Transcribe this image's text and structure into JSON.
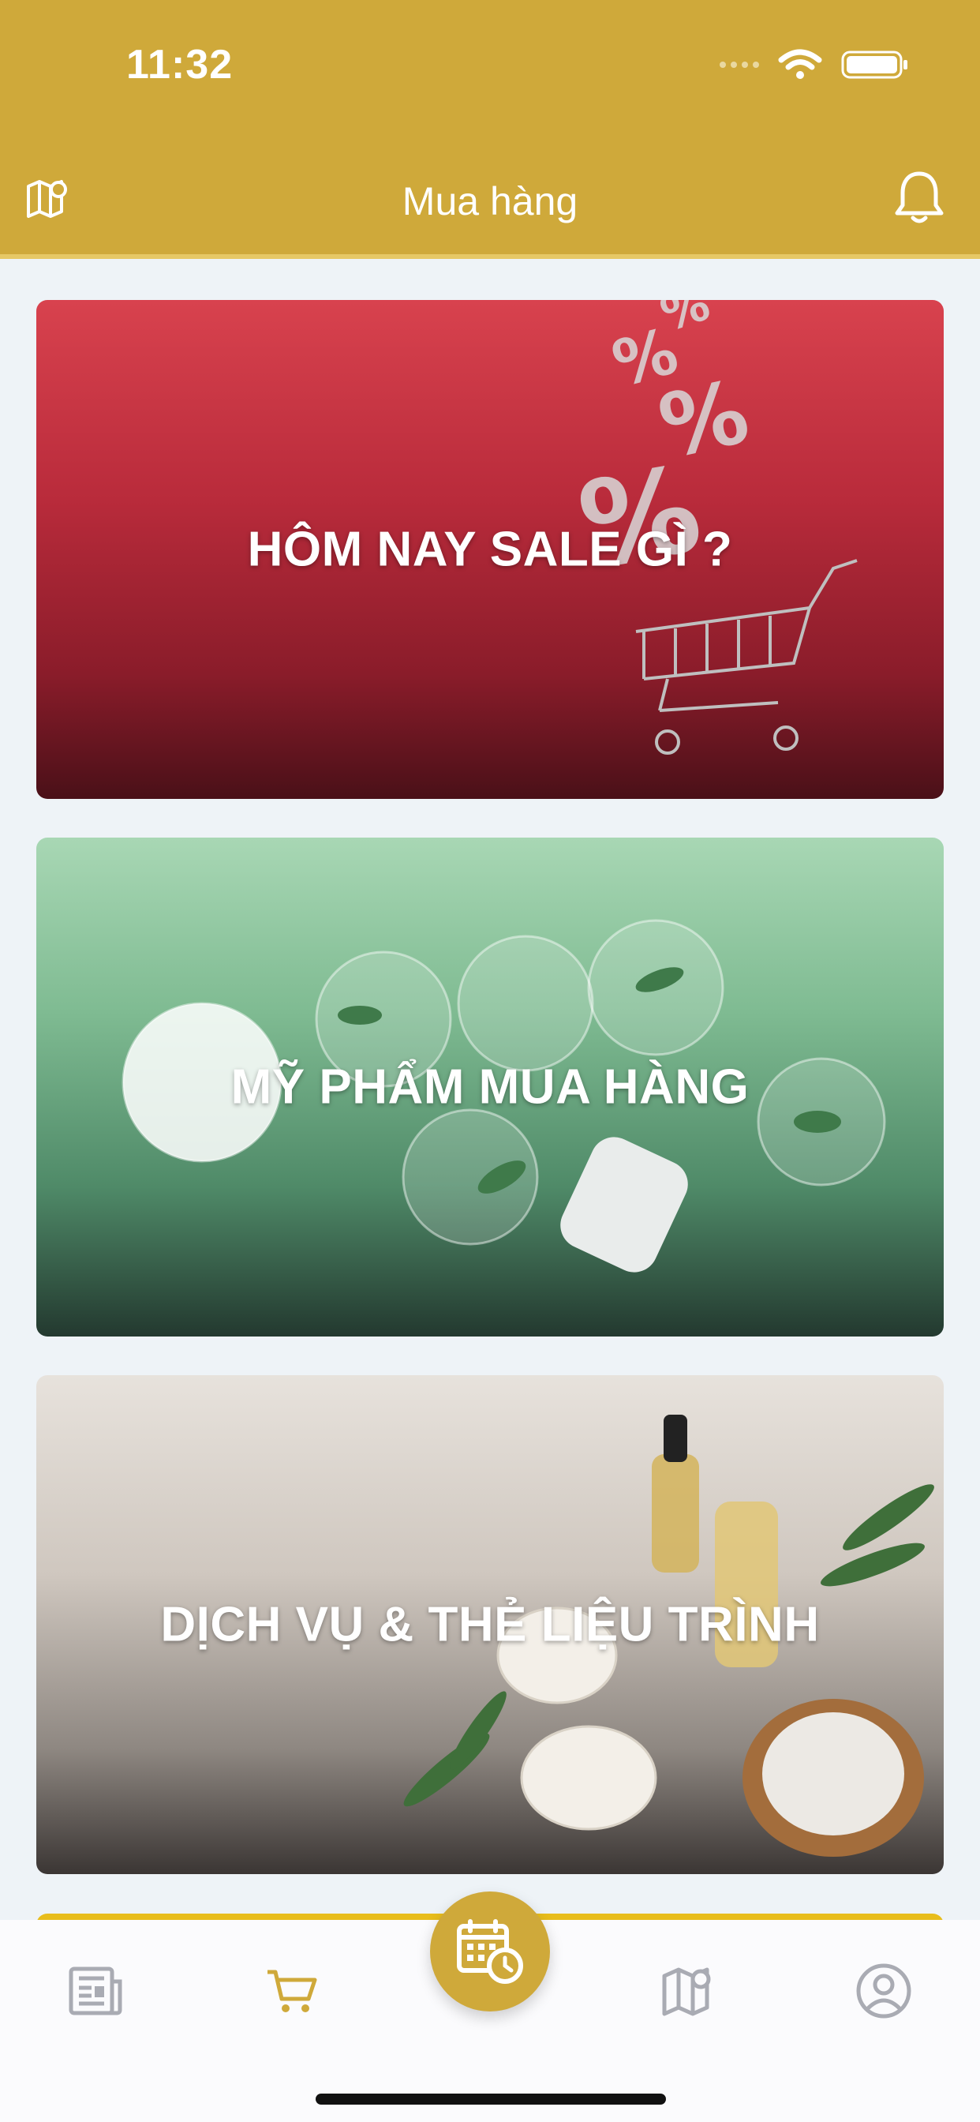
{
  "status_bar": {
    "time": "11:32"
  },
  "header": {
    "title": "Mua hàng",
    "left_icon": "map-pin-icon",
    "right_icon": "bell-icon"
  },
  "cards": [
    {
      "label": "HÔM NAY SALE GÌ ?"
    },
    {
      "label": "MỸ PHẨM MUA HÀNG"
    },
    {
      "label": "DỊCH VỤ & THẺ LIỆU TRÌNH"
    }
  ],
  "tabbar": {
    "items": [
      {
        "icon": "newspaper-icon",
        "active": false
      },
      {
        "icon": "cart-icon",
        "active": true
      },
      {
        "icon": "calendar-clock-icon",
        "center": true
      },
      {
        "icon": "map-pin-icon",
        "active": false
      },
      {
        "icon": "user-icon",
        "active": false
      }
    ]
  },
  "colors": {
    "accent": "#cfa93a",
    "inactive": "#a9abb3"
  }
}
